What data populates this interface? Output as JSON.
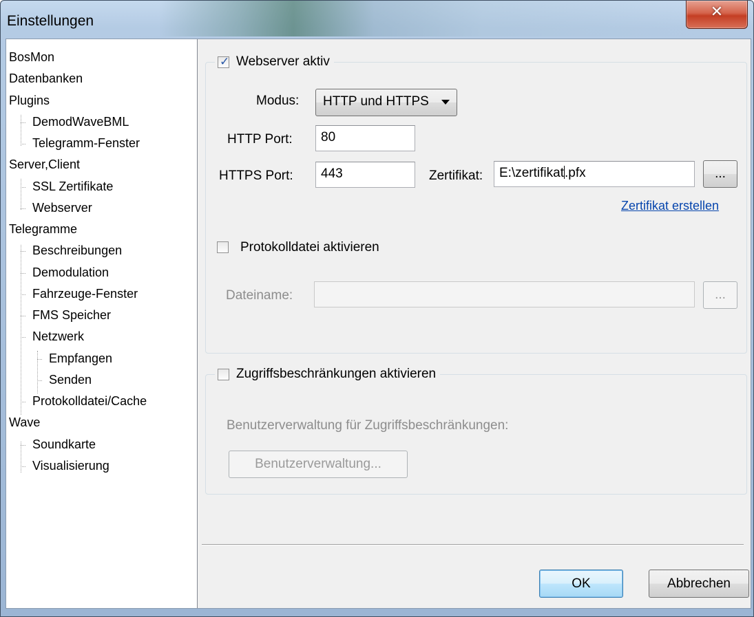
{
  "window": {
    "title": "Einstellungen"
  },
  "tree": {
    "items": [
      {
        "label": "BosMon",
        "level": 0
      },
      {
        "label": "Datenbanken",
        "level": 0
      },
      {
        "label": "Plugins",
        "level": 0
      },
      {
        "label": "DemodWaveBML",
        "level": 1
      },
      {
        "label": "Telegramm-Fenster",
        "level": 1
      },
      {
        "label": "Server,Client",
        "level": 0
      },
      {
        "label": "SSL Zertifikate",
        "level": 1
      },
      {
        "label": "Webserver",
        "level": 1
      },
      {
        "label": "Telegramme",
        "level": 0
      },
      {
        "label": "Beschreibungen",
        "level": 1
      },
      {
        "label": "Demodulation",
        "level": 1
      },
      {
        "label": "Fahrzeuge-Fenster",
        "level": 1
      },
      {
        "label": "FMS Speicher",
        "level": 1
      },
      {
        "label": "Netzwerk",
        "level": 1
      },
      {
        "label": "Empfangen",
        "level": 2
      },
      {
        "label": "Senden",
        "level": 2
      },
      {
        "label": "Protokolldatei/Cache",
        "level": 1
      },
      {
        "label": "Wave",
        "level": 0
      },
      {
        "label": "Soundkarte",
        "level": 1
      },
      {
        "label": "Visualisierung",
        "level": 1
      }
    ]
  },
  "webserver": {
    "enabled_label": "Webserver aktiv",
    "enabled": true,
    "mode_label": "Modus:",
    "mode_value": "HTTP und HTTPS",
    "http_port_label": "HTTP Port:",
    "http_port": "80",
    "https_port_label": "HTTPS Port:",
    "https_port": "443",
    "cert_label": "Zertifikat:",
    "cert_value_before": "E:\\zertifikat",
    "cert_value_after": ".pfx",
    "browse_label": "...",
    "create_cert_link": "Zertifikat erstellen"
  },
  "logfile": {
    "enabled_label": "Protokolldatei aktivieren",
    "enabled": false,
    "filename_label": "Dateiname:",
    "filename": "",
    "browse_label": "..."
  },
  "access": {
    "enabled_label": "Zugriffsbeschränkungen aktivieren",
    "enabled": false,
    "user_mgmt_label": "Benutzerverwaltung für Zugriffsbeschränkungen:",
    "user_mgmt_button": "Benutzerverwaltung..."
  },
  "buttons": {
    "ok": "OK",
    "cancel": "Abbrechen"
  },
  "colors": {
    "close_button": "#c43e24",
    "link": "#0645ad",
    "checkmark": "#2a58a8"
  },
  "icons": {
    "close": "close-icon",
    "check": "checkmark-icon"
  }
}
